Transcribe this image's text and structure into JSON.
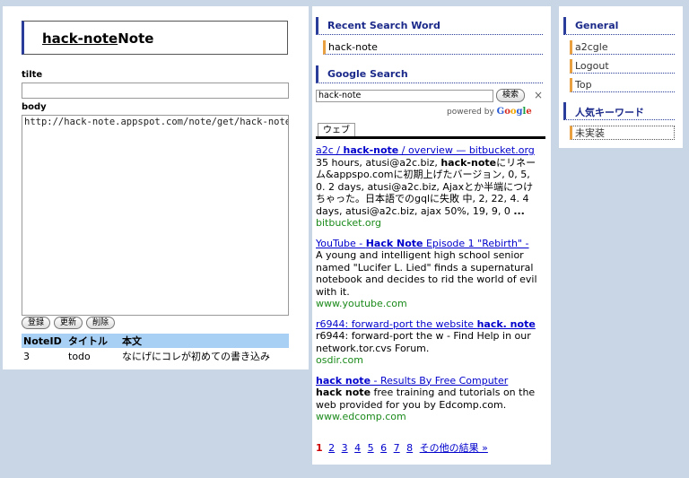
{
  "note": {
    "title_brand": "hack-note",
    "title_suffix": "Note",
    "tilte_label": "tilte",
    "body_label": "body",
    "body_value": "http://hack-note.appspot.com/note/get/hack-note/#",
    "buttons": {
      "register": "登録",
      "update": "更新",
      "delete": "削除"
    },
    "table": {
      "headers": [
        "NoteID",
        "タイトル",
        "本文"
      ],
      "rows": [
        [
          "3",
          "todo",
          "なにげにコレが初めての書き込み"
        ]
      ]
    }
  },
  "search": {
    "recent_heading": "Recent Search Word",
    "recent_word": "hack-note",
    "google_heading": "Google Search",
    "query": "hack-note",
    "search_button": "検索",
    "close_symbol": "×",
    "powered_by": "powered by",
    "tab_label": "ウェブ",
    "results": [
      {
        "title_pre": "a2c / ",
        "title_bold": "hack-note",
        "title_post": " / overview — bitbucket.org",
        "snippet_parts": [
          "35 hours, atusi@a2c.biz, ",
          "hack-note",
          "にリネーム&appspo.comに初期上げたバージョン, 0, 5, 0. 2 days, atusi@a2c.biz, Ajaxとか半端につけちゃった。日本語でのgqlに失敗 中, 2, 22, 4. 4 days, atusi@a2c.biz, ajax 50%, 19, 9, 0 ",
          "..."
        ],
        "url": "bitbucket.org"
      },
      {
        "title_pre": "YouTube - ",
        "title_bold": "Hack Note",
        "title_post": " Episode 1 \"Rebirth\" -",
        "snippet_parts": [
          "A young and intelligent high school senior named \"Lucifer L. Lied\" finds a supernatural notebook and decides to rid the world of evil with it.",
          "",
          "",
          ""
        ],
        "url": "www.youtube.com"
      },
      {
        "title_pre": "r6944: forward-port the website ",
        "title_bold": "hack. note",
        "title_post": "",
        "snippet_parts": [
          "r6944: forward-port the w - Find Help in our network.tor.cvs Forum.",
          "",
          "",
          ""
        ],
        "url": "osdir.com"
      },
      {
        "title_pre": "",
        "title_bold": "hack note",
        "title_post": " - Results By Free Computer",
        "snippet_parts": [
          "",
          "hack note",
          " free training and tutorials on the web provided for you by Edcomp.com.",
          ""
        ],
        "url": "www.edcomp.com"
      }
    ],
    "pager": {
      "current": "1",
      "pages": [
        "2",
        "3",
        "4",
        "5",
        "6",
        "7",
        "8"
      ],
      "more": "その他の結果 »"
    }
  },
  "general": {
    "heading": "General",
    "items": [
      "a2cgle",
      "Logout",
      "Top"
    ],
    "keyword_heading": "人気キーワード",
    "keyword_item": "未実装"
  }
}
